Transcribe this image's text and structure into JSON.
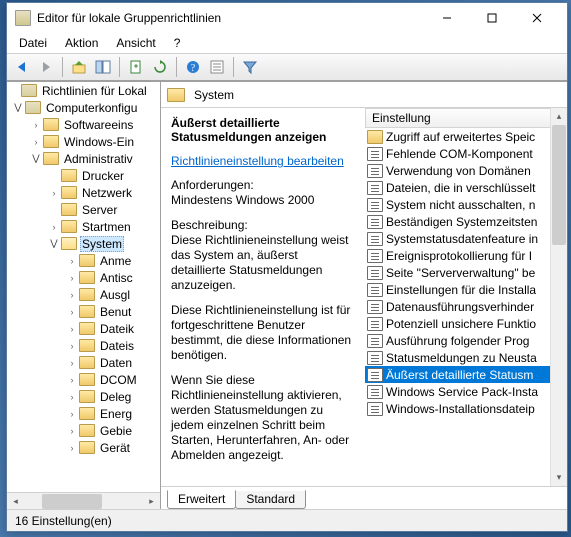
{
  "window": {
    "title": "Editor für lokale Gruppenrichtlinien"
  },
  "menu": {
    "file": "Datei",
    "action": "Aktion",
    "view": "Ansicht",
    "help": "?"
  },
  "tree": {
    "root": "Richtlinien für Lokal",
    "computer": "Computerkonfigu",
    "software": "Softwareeins",
    "windows": "Windows-Ein",
    "admin": "Administrativ",
    "drucker": "Drucker",
    "netzwerk": "Netzwerk",
    "server": "Server",
    "startmen": "Startmen",
    "system": "System",
    "children": [
      "Anme",
      "Antisc",
      "Ausgl",
      "Benut",
      "Dateik",
      "Dateis",
      "Daten",
      "DCOM",
      "Deleg",
      "Energ",
      "Gebie",
      "Gerät"
    ]
  },
  "right": {
    "header": "System",
    "title": "Äußerst detaillierte Statusmeldungen anzeigen",
    "edit_link": "Richtlinieneinstellung bearbeiten",
    "req_label": "Anforderungen:",
    "req_value": "Mindestens Windows 2000",
    "desc_label": "Beschreibung:",
    "desc_p1": "Diese Richtlinieneinstellung weist das System an, äußerst detaillierte Statusmeldungen anzuzeigen.",
    "desc_p2": "Diese Richtlinieneinstellung ist für fortgeschrittene Benutzer bestimmt, die diese Informationen benötigen.",
    "desc_p3": "Wenn Sie diese Richtlinieneinstellung aktivieren, werden Statusmeldungen zu jedem einzelnen Schritt beim Starten, Herunterfahren, An- oder Abmelden angezeigt."
  },
  "list": {
    "header": "Einstellung",
    "items": [
      {
        "label": "Zugriff auf erweitertes Speic",
        "icon": "folder"
      },
      {
        "label": "Fehlende COM-Komponent"
      },
      {
        "label": "Verwendung von Domänen"
      },
      {
        "label": "Dateien, die in verschlüsselt"
      },
      {
        "label": "System nicht ausschalten, n"
      },
      {
        "label": "Beständigen Systemzeitsten"
      },
      {
        "label": "Systemstatusdatenfeature in"
      },
      {
        "label": "Ereignisprotokollierung für I"
      },
      {
        "label": "Seite \"Serververwaltung\" be"
      },
      {
        "label": "Einstellungen für die Installa"
      },
      {
        "label": "Datenausführungsverhinder"
      },
      {
        "label": "Potenziell unsichere Funktio"
      },
      {
        "label": "Ausführung folgender Prog"
      },
      {
        "label": "Statusmeldungen zu Neusta"
      },
      {
        "label": "Äußerst detaillierte Statusm",
        "selected": true
      },
      {
        "label": "Windows Service Pack-Insta"
      },
      {
        "label": "Windows-Installationsdateip"
      }
    ]
  },
  "tabs": {
    "extended": "Erweitert",
    "standard": "Standard"
  },
  "status": "16 Einstellung(en)"
}
